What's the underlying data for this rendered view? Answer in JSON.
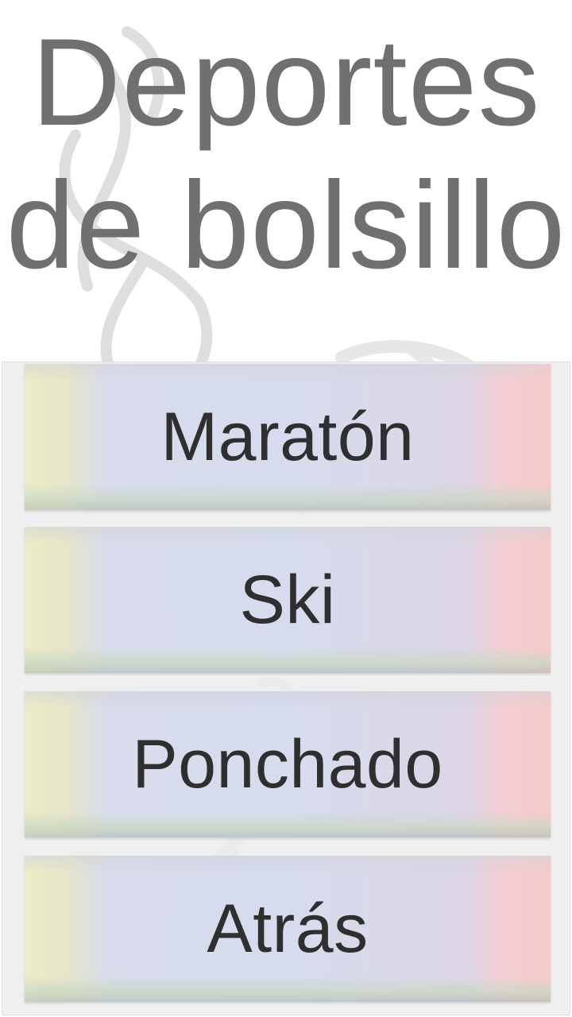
{
  "header": {
    "title_line1": "Deportes",
    "title_line2": "de bolsillo"
  },
  "menu": {
    "items": [
      {
        "label": "Maratón"
      },
      {
        "label": "Ski"
      },
      {
        "label": "Ponchado"
      },
      {
        "label": "Atrás"
      }
    ]
  },
  "colors": {
    "title": "#707070",
    "button_text": "#2f2f2f",
    "button_left_tint": "#ececc6",
    "button_center_tint": "#d6dcee",
    "button_right_tint": "#f6caca",
    "panel_background": "#ebebeb"
  },
  "icons": {
    "background": "sport-figures-sketch-icon"
  }
}
